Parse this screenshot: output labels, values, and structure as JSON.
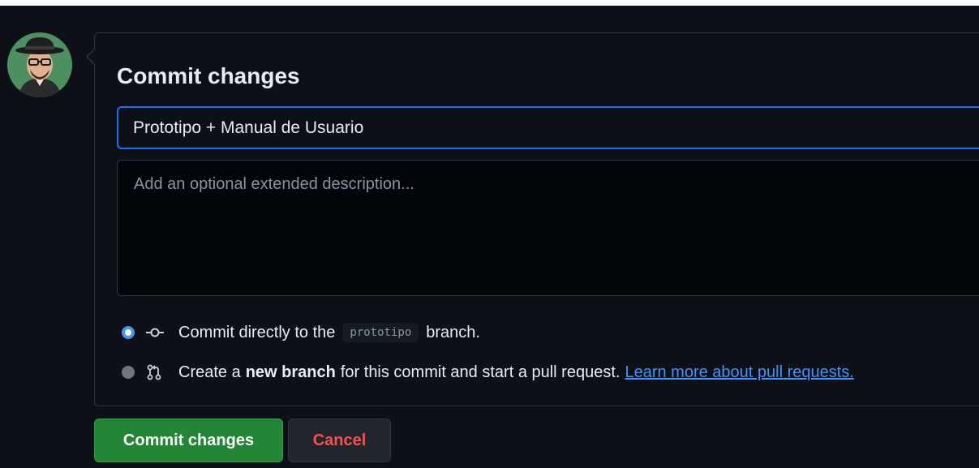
{
  "title": "Commit changes",
  "summary": {
    "value": "Prototipo + Manual de Usuario"
  },
  "description": {
    "placeholder": "Add an optional extended description..."
  },
  "options": {
    "direct": {
      "prefix": "Commit directly to the",
      "branch": "prototipo",
      "suffix": "branch.",
      "checked": true,
      "icon": "git-commit-icon"
    },
    "new_branch": {
      "prefix": "Create a",
      "strong": "new branch",
      "suffix": "for this commit and start a pull request.",
      "link": "Learn more about pull requests.",
      "checked": false,
      "icon": "git-pull-request-icon"
    }
  },
  "buttons": {
    "commit": "Commit changes",
    "cancel": "Cancel"
  },
  "colors": {
    "accent": "#1f6feb",
    "primary_button": "#238636",
    "danger_text": "#f85149",
    "link": "#4493f8"
  }
}
